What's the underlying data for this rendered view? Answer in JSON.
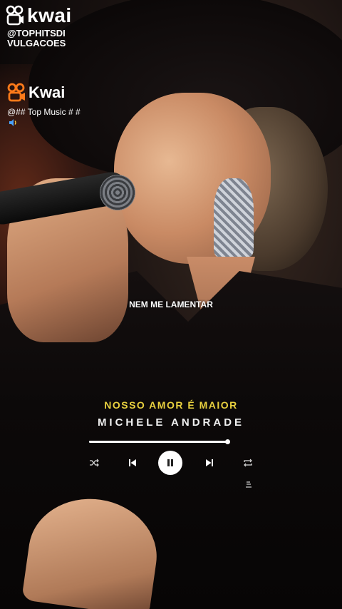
{
  "watermark": {
    "brand": "kwai",
    "handle_line1": "@TOPHITSDI",
    "handle_line2": "VULGACOES"
  },
  "overlay": {
    "brand": "Kwai",
    "account": "@## Top Music # #"
  },
  "lyric_line": "NEM ME LAMENTAR",
  "player": {
    "song_title": "NOSSO AMOR É MAIOR",
    "artist": "MICHELE ANDRADE",
    "progress_fraction": 0.995,
    "accent_color": "#e9d13f"
  },
  "icons": [
    "kwai-logo-icon",
    "speaker-icon",
    "shuffle-icon",
    "previous-icon",
    "pause-icon",
    "next-icon",
    "repeat-icon",
    "lyrics-icon"
  ]
}
